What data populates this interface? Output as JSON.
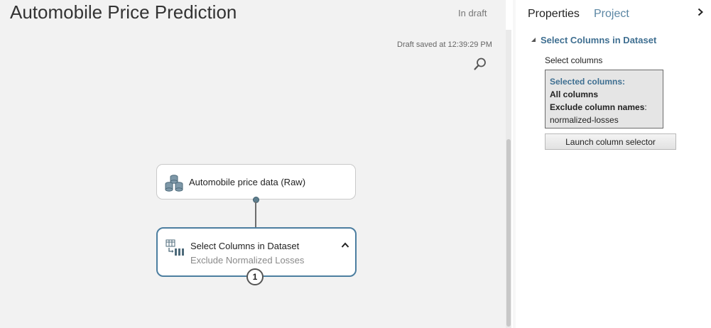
{
  "experiment": {
    "title": "Automobile Price Prediction",
    "status": "In draft",
    "draft_saved": "Draft saved at 12:39:29 PM"
  },
  "canvas": {
    "modules": [
      {
        "title": "Automobile price data (Raw)",
        "icon": "dataset-icon"
      },
      {
        "title": "Select Columns in Dataset",
        "subtitle": "Exclude Normalized Losses",
        "icon": "select-columns-icon",
        "badge": "1",
        "selected": true
      }
    ]
  },
  "properties": {
    "tabs": [
      "Properties",
      "Project"
    ],
    "section_title": "Select Columns in Dataset",
    "param_label": "Select columns",
    "selection": {
      "heading": "Selected columns:",
      "all_label": "All columns",
      "exclude_label": "Exclude column names",
      "exclude_colon": ":",
      "exclude_value": "normalized-losses"
    },
    "launch_button": "Launch column selector"
  },
  "icons": {
    "search": "search-icon",
    "collapse": "chevron-up-icon",
    "expand_pane": "chevron-right-icon",
    "section_toggle": "triangle-down-icon"
  },
  "colors": {
    "accent": "#3f6f91",
    "selected_border": "#4c7ea0",
    "canvas_bg": "#f2f2f2"
  }
}
